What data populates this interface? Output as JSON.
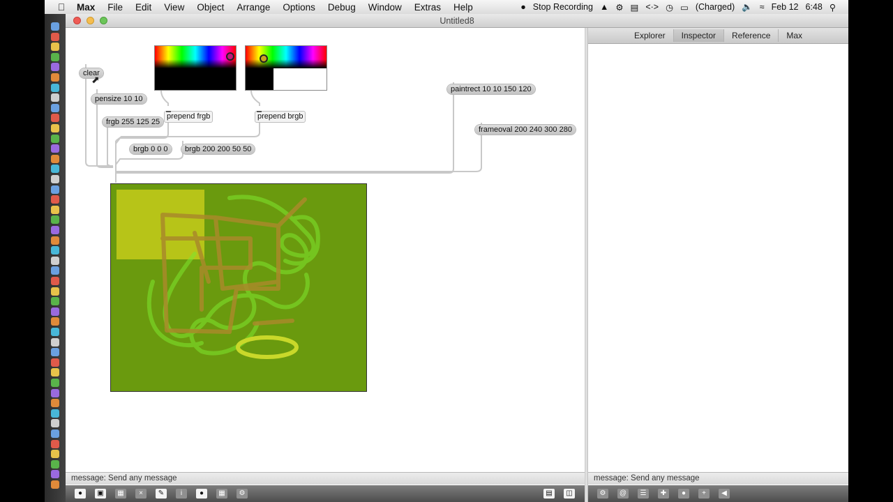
{
  "menubar": {
    "app": "Max",
    "menus": [
      "File",
      "Edit",
      "View",
      "Object",
      "Arrange",
      "Options",
      "Debug",
      "Window",
      "Extras",
      "Help"
    ],
    "recording": "Stop Recording",
    "battery": "(Charged)",
    "date": "Feb 12",
    "time": "6:48",
    "icons": [
      "apple-icon",
      "record-icon",
      "drive-icon",
      "gear-icon",
      "battery-icon",
      "wifi-icon",
      "search-icon"
    ]
  },
  "window": {
    "title": "Untitled8"
  },
  "patcher": {
    "messages": {
      "clear": "clear",
      "pensize": "pensize 10 10",
      "frgb": "frgb 255 125 25",
      "brgb_black": "brgb 0 0 0",
      "brgb_color": "brgb 200 200 50 50",
      "paintrect": "paintrect 10 10 150 120",
      "frameoval": "frameoval 200 240 300 280"
    },
    "objects": {
      "prepend_frgb": "prepend frgb",
      "prepend_brgb": "prepend brgb"
    },
    "colors": {
      "lcd_bg": "#6a9a0e",
      "rect_fill": "#b7c418",
      "pen_brown": "#a98a2a",
      "pen_green": "#7ee82e",
      "oval": "#c9d82a"
    }
  },
  "status": {
    "left": "message: Send any message",
    "right": "message: Send any message"
  },
  "sidebar": {
    "tabs": [
      "Explorer",
      "Inspector",
      "Reference",
      "Max"
    ],
    "active_tab": "Inspector"
  }
}
